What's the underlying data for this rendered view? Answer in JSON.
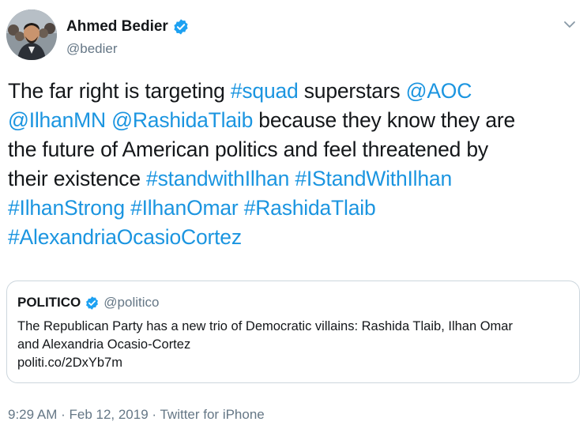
{
  "author": {
    "name": "Ahmed Bedier",
    "handle": "@bedier",
    "verified_icon": "verified-badge-icon"
  },
  "tweet": {
    "segments_line1": [
      {
        "text": "The far right is targeting ",
        "link": false
      },
      {
        "text": "#squad",
        "link": true
      },
      {
        "text": " superstars ",
        "link": false
      },
      {
        "text": "@AOC",
        "link": true
      }
    ],
    "segments_line2": [
      {
        "text": "@IlhanMN",
        "link": true
      },
      {
        "text": " ",
        "link": false
      },
      {
        "text": "@RashidaTlaib",
        "link": true
      },
      {
        "text": " because they know they are",
        "link": false
      }
    ],
    "segments_line3": [
      {
        "text": "the future of American politics and feel threatened by",
        "link": false
      }
    ],
    "segments_line4": [
      {
        "text": "their existence ",
        "link": false
      },
      {
        "text": "#standwithIlhan",
        "link": true
      },
      {
        "text": " ",
        "link": false
      },
      {
        "text": "#IStandWithIlhan",
        "link": true
      }
    ],
    "segments_line5": [
      {
        "text": "#IlhanStrong",
        "link": true
      },
      {
        "text": " ",
        "link": false
      },
      {
        "text": "#IlhanOmar",
        "link": true
      },
      {
        "text": " ",
        "link": false
      },
      {
        "text": "#RashidaTlaib",
        "link": true
      }
    ],
    "segments_line6": [
      {
        "text": "#AlexandriaOcasioCortez",
        "link": true
      }
    ]
  },
  "quote": {
    "name": "POLITICO",
    "handle": "@politico",
    "body_line1": "The Republican Party has a new trio of Democratic villains: Rashida Tlaib, Ilhan Omar",
    "body_line2": "and Alexandria Ocasio-Cortez",
    "link": "politi.co/2DxYb7m"
  },
  "meta": {
    "text": "9:29 AM · Feb 12, 2019 · Twitter for iPhone"
  },
  "colors": {
    "link": "#1b95e0",
    "verified": "#1da1f2",
    "secondary_text": "#657786",
    "border": "#ccd6dd"
  }
}
